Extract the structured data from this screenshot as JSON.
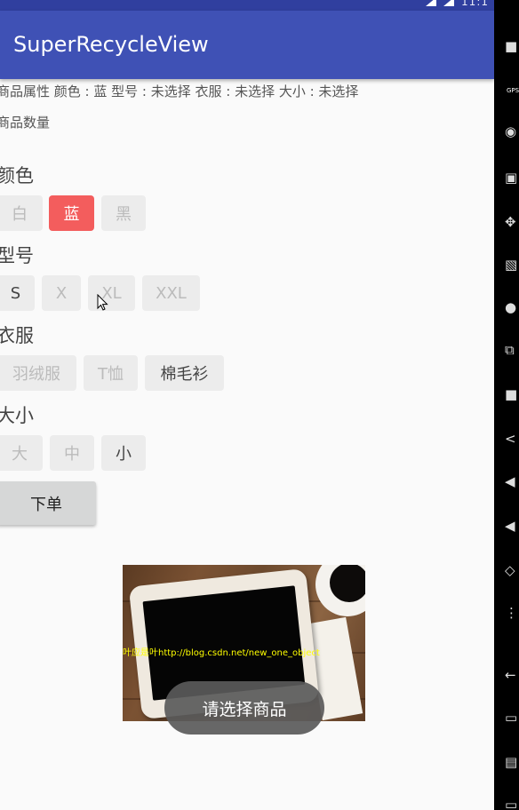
{
  "status_bar": {
    "time": "11:1"
  },
  "app_bar": {
    "title": "SuperRecycleView"
  },
  "info": {
    "attributes_line": "商品属性 颜色 : 蓝 型号 : 未选择 衣服 : 未选择 大小 : 未选择",
    "quantity_line": "商品数量"
  },
  "groups": [
    {
      "title": "颜色",
      "options": [
        "白",
        "蓝",
        "黑"
      ],
      "selected": "蓝"
    },
    {
      "title": "型号",
      "options": [
        "S",
        "X",
        "XL",
        "XXL"
      ],
      "enabled": [
        "S"
      ]
    },
    {
      "title": "衣服",
      "options": [
        "羽绒服",
        "T恤",
        "棉毛衫"
      ],
      "enabled": [
        "棉毛衫"
      ]
    },
    {
      "title": "大小",
      "options": [
        "大",
        "中",
        "小"
      ],
      "enabled": [
        "小"
      ]
    }
  ],
  "order_button": "下单",
  "image": {
    "watermark": "叶应是叶http://blog.csdn.net/new_one_object"
  },
  "toast": "请选择商品",
  "colors": {
    "app_bar": "#3f51b5",
    "status_bar": "#303f9f",
    "selected_chip": "#f35d5d",
    "chip_bg": "#ececec"
  },
  "rail_icons": [
    "lock-icon",
    "gps-icon",
    "camera-icon",
    "video-icon",
    "move-icon",
    "id-icon",
    "dot-icon",
    "rss-icon",
    "chat-icon",
    "share-icon",
    "volume-up-icon",
    "volume-down-icon",
    "rotate-icon",
    "zoom-icon",
    "back-icon",
    "home-icon",
    "recents-icon",
    "menu-icon"
  ]
}
